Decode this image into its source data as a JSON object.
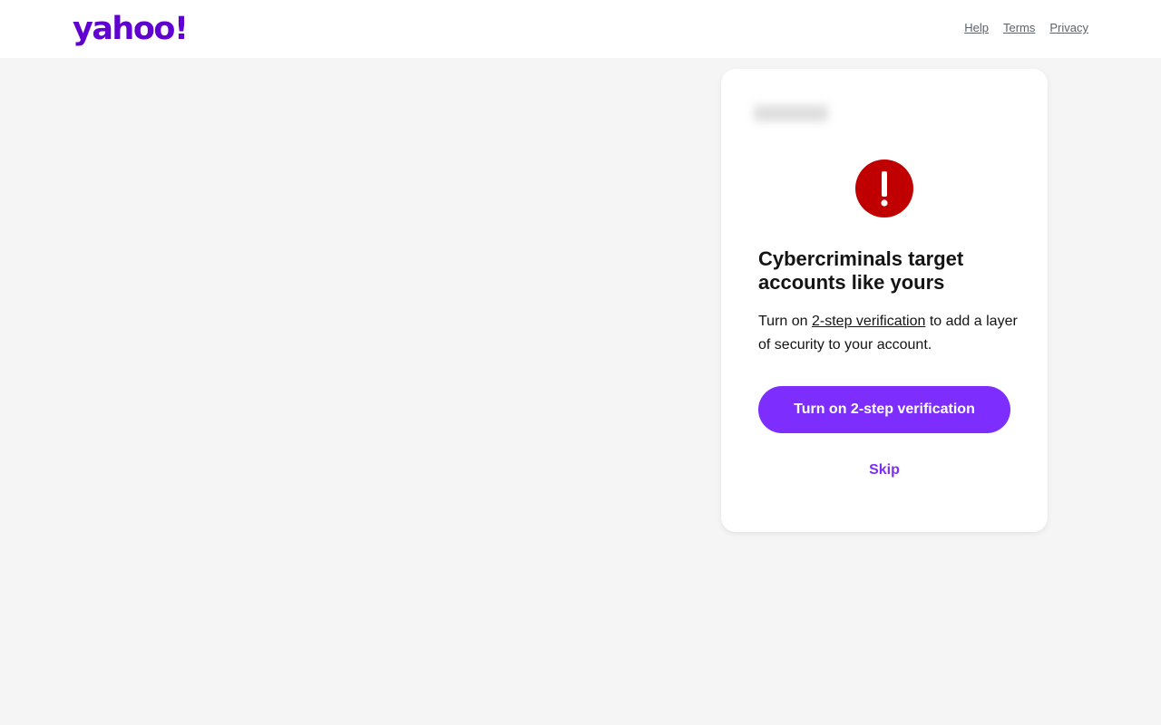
{
  "header": {
    "logo_text": "yahoo!",
    "nav": {
      "help": "Help",
      "terms": "Terms",
      "privacy": "Privacy"
    }
  },
  "card": {
    "heading": "Cybercriminals target accounts like yours",
    "body_prefix": "Turn on ",
    "body_link": "2-step verification",
    "body_suffix": " to add a layer of security to your account.",
    "primary_button": "Turn on 2-step verification",
    "skip_button": "Skip",
    "alert_icon": "exclamation-circle-icon"
  },
  "colors": {
    "brand": "#6001d2",
    "accent": "#7d2eff",
    "alert": "#c00000",
    "background": "#f5f5f5"
  }
}
